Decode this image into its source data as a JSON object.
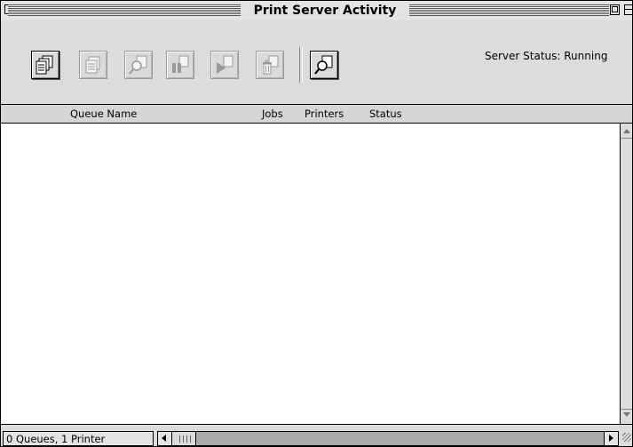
{
  "window": {
    "title": "Print Server Activity"
  },
  "toolbar": {
    "server_status": "Server Status: Running",
    "buttons": [
      {
        "name": "queue-info-button",
        "enabled": true
      },
      {
        "name": "document-info-button",
        "enabled": false
      },
      {
        "name": "inspect-button",
        "enabled": false
      },
      {
        "name": "pause-button",
        "enabled": false
      },
      {
        "name": "resume-button",
        "enabled": false
      },
      {
        "name": "delete-button",
        "enabled": false
      },
      {
        "name": "find-button",
        "enabled": true
      }
    ]
  },
  "columns": {
    "queue_name": "Queue Name",
    "jobs": "Jobs",
    "printers": "Printers",
    "status": "Status"
  },
  "queues": [],
  "footer": {
    "summary": "0 Queues, 1 Printer"
  }
}
